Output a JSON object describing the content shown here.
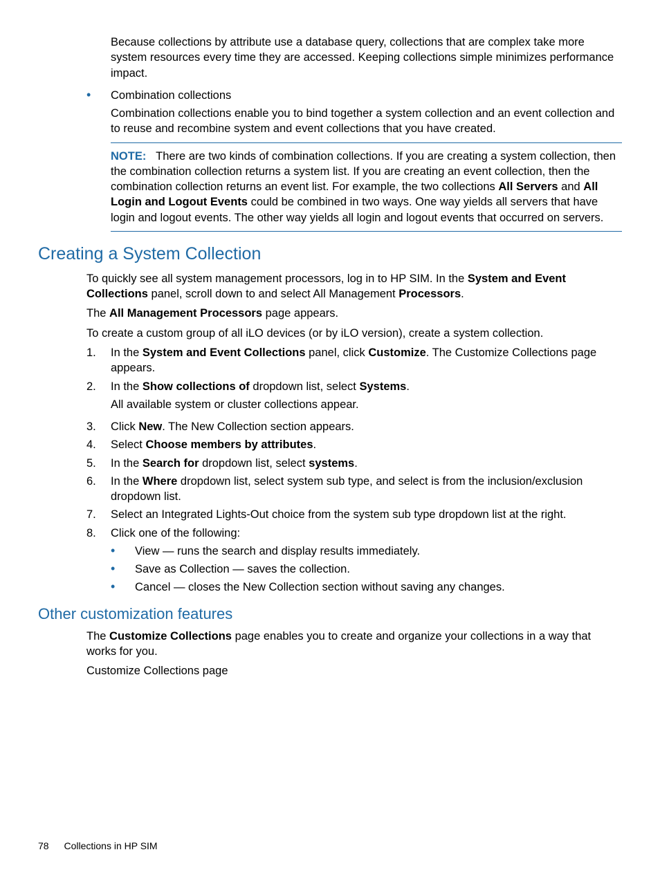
{
  "para_db": "Because collections by attribute use a database query, collections that are complex take more system resources every time they are accessed. Keeping collections simple minimizes performance impact.",
  "bullet_combo_title": "Combination collections",
  "bullet_combo_body": "Combination collections enable you to bind together a system collection and an event collection and to reuse and recombine system and event collections that you have created.",
  "note": {
    "label": "NOTE:",
    "t1": "There are two kinds of combination collections. If you are creating a system collection, then the combination collection returns a system list. If you are creating an event collection, then the combination collection returns an event list. For example, the two collections ",
    "b1": "All Servers",
    "t2": " and ",
    "b2": "All Login and Logout Events",
    "t3": " could be combined in two ways. One way yields all servers that have login and logout events. The other way yields all login and logout events that occurred on servers."
  },
  "h2_creating": "Creating a System Collection",
  "creating": {
    "p1a": "To quickly see all system management processors, log in to HP SIM. In the ",
    "p1b": "System and Event Collections",
    "p1c": " panel, scroll down to and select All Management ",
    "p1d": "Processors",
    "p1e": ".",
    "p2a": "The ",
    "p2b": "All Management Processors",
    "p2c": " page appears.",
    "p3": "To create a custom group of all iLO devices (or by iLO version), create a system collection."
  },
  "steps": {
    "s1a": "In the ",
    "s1b": "System and Event Collections",
    "s1c": " panel, click ",
    "s1d": "Customize",
    "s1e": ". The Customize Collections page appears.",
    "s2a": "In the ",
    "s2b": "Show collections of",
    "s2c": " dropdown list, select ",
    "s2d": "Systems",
    "s2e": ".",
    "s2f": "All available system or cluster collections appear.",
    "s3a": "Click ",
    "s3b": "New",
    "s3c": ". The New Collection section appears.",
    "s4a": "Select ",
    "s4b": "Choose members by attributes",
    "s4c": ".",
    "s5a": "In the ",
    "s5b": "Search for",
    "s5c": " dropdown list, select ",
    "s5d": "systems",
    "s5e": ".",
    "s6a": "In the ",
    "s6b": "Where",
    "s6c": " dropdown list, select system sub type, and select is from the inclusion/exclusion dropdown list.",
    "s7": "Select an Integrated Lights-Out choice from the system sub type dropdown list at the right.",
    "s8": "Click one of the following:",
    "sb1": "View — runs the search and display results immediately.",
    "sb2": "Save as Collection — saves the collection.",
    "sb3": "Cancel — closes the New Collection section without saving any changes."
  },
  "num": {
    "n1": "1.",
    "n2": "2.",
    "n3": "3.",
    "n4": "4.",
    "n5": "5.",
    "n6": "6.",
    "n7": "7.",
    "n8": "8."
  },
  "h3_other": "Other customization features",
  "other": {
    "p1a": "The ",
    "p1b": "Customize Collections",
    "p1c": " page enables you to create and organize your collections in a way that works for you.",
    "p2": "Customize Collections page"
  },
  "footer": {
    "page": "78",
    "title": "Collections in HP SIM"
  }
}
